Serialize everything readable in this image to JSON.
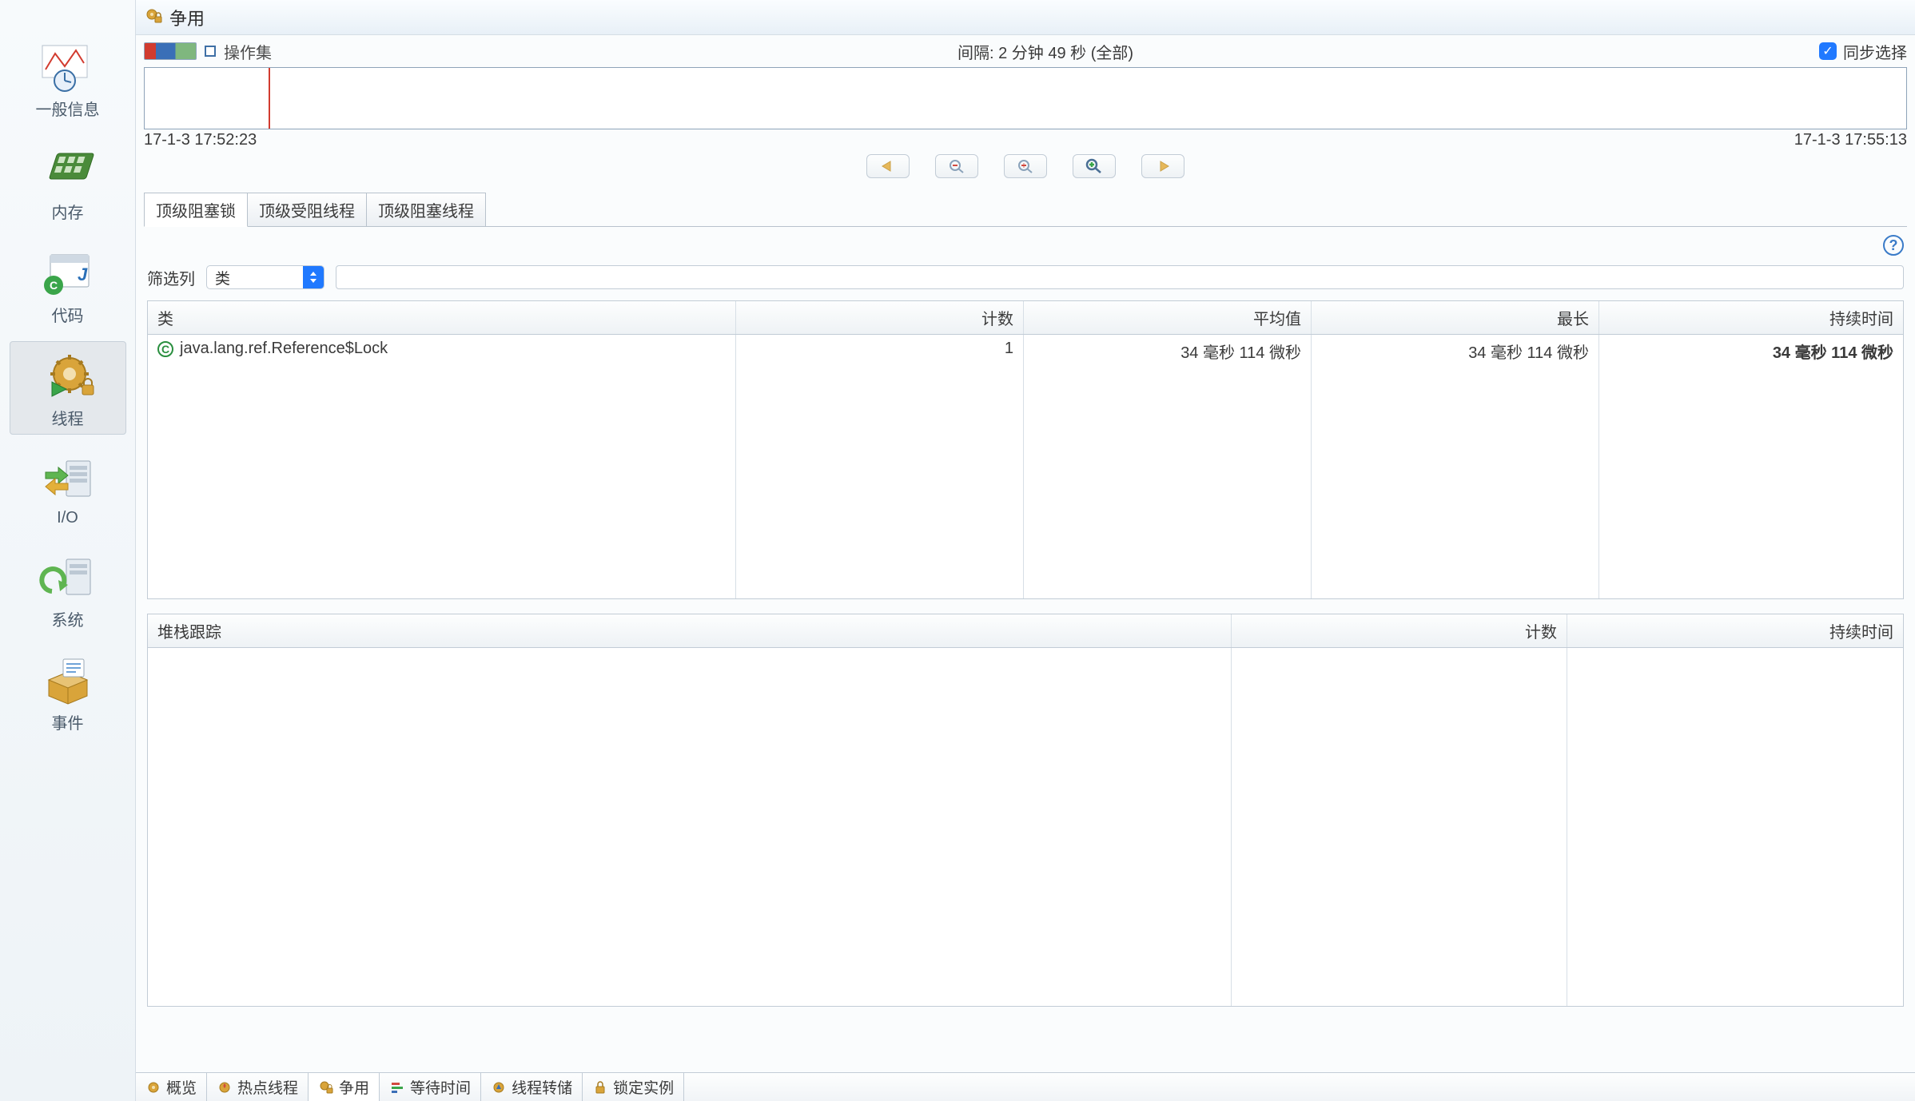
{
  "sidebar": {
    "items": [
      {
        "label": "一般信息"
      },
      {
        "label": "内存"
      },
      {
        "label": "代码"
      },
      {
        "label": "线程"
      },
      {
        "label": "I/O"
      },
      {
        "label": "系统"
      },
      {
        "label": "事件"
      }
    ],
    "active_index": 3
  },
  "header": {
    "title": "争用"
  },
  "toolbar": {
    "opset_label": "操作集",
    "interval_label": "间隔: 2 分钟 49 秒 (全部)",
    "sync_label": "同步选择",
    "sync_checked": true
  },
  "timeline": {
    "start": "17-1-3 17:52:23",
    "end": "17-1-3 17:55:13"
  },
  "subtabs": {
    "items": [
      "顶级阻塞锁",
      "顶级受阻线程",
      "顶级阻塞线程"
    ],
    "active_index": 0
  },
  "filter": {
    "label": "筛选列",
    "select_value": "类",
    "text": ""
  },
  "table1": {
    "columns": [
      "类",
      "计数",
      "平均值",
      "最长",
      "持续时间"
    ],
    "rows": [
      {
        "class": "java.lang.ref.Reference$Lock",
        "count": "1",
        "avg": "34 毫秒 114 微秒",
        "max": "34 毫秒 114 微秒",
        "duration": "34 毫秒 114 微秒"
      }
    ]
  },
  "table2": {
    "columns": [
      "堆栈跟踪",
      "计数",
      "持续时间"
    ]
  },
  "bottom_tabs": {
    "items": [
      "概览",
      "热点线程",
      "争用",
      "等待时间",
      "线程转储",
      "锁定实例"
    ],
    "active_index": 2
  }
}
